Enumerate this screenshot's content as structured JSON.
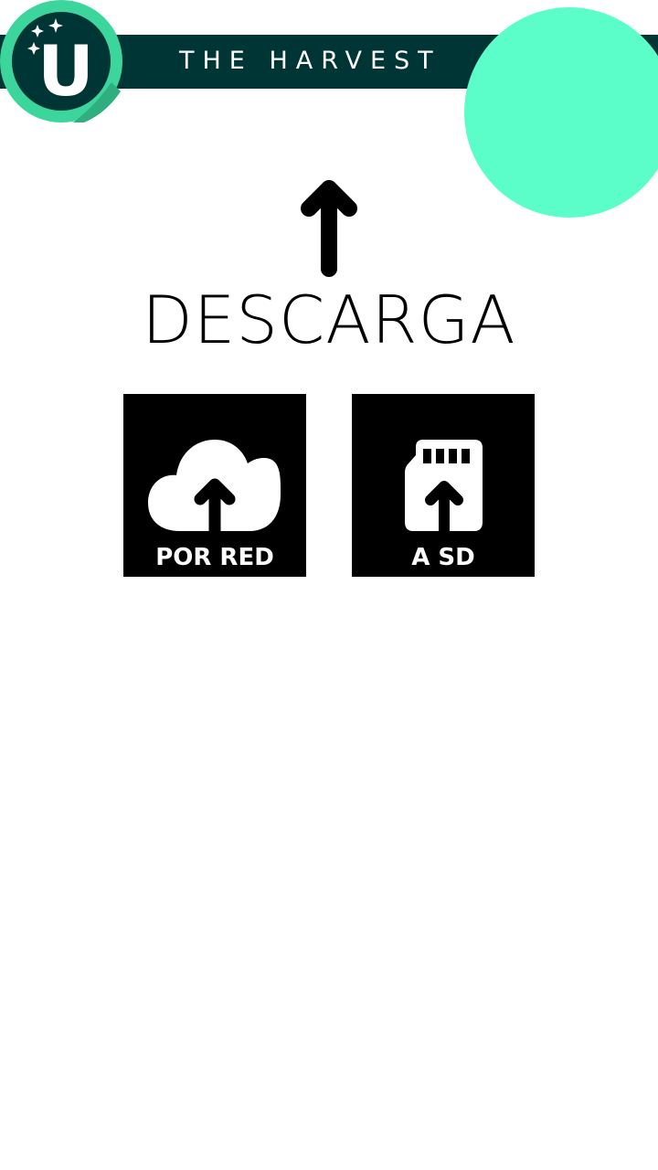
{
  "header": {
    "title": "THE HARVEST",
    "logo_letter": "U",
    "bar_color": "#003536",
    "logo_ring_color": "#3cd69c",
    "accent_color": "#5bfec9"
  },
  "main": {
    "title": "DESCARGA",
    "title_icon": "arrow-up-icon",
    "options": [
      {
        "label": "POR RED",
        "icon": "cloud-upload-icon"
      },
      {
        "label": "A SD",
        "icon": "sd-card-upload-icon"
      }
    ]
  }
}
